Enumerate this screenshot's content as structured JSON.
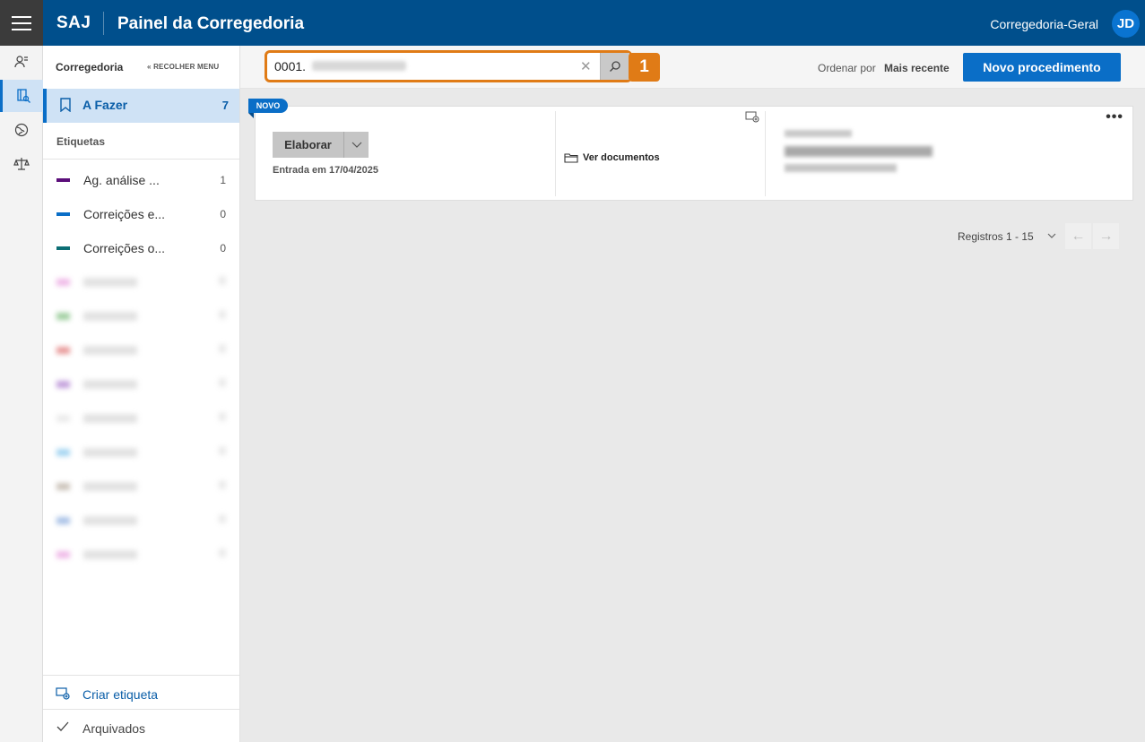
{
  "app": {
    "brand": "SAJ",
    "title": "Painel da Corregedoria",
    "user_name": "Corregedoria-Geral",
    "user_initials": "JD"
  },
  "rail": {
    "items": [
      {
        "name": "users-icon"
      },
      {
        "name": "documents-search-icon",
        "active": true
      },
      {
        "name": "globe-icon"
      },
      {
        "name": "scales-icon"
      }
    ]
  },
  "sidebar": {
    "title": "Corregedoria",
    "collapse_label": "RECOLHER MENU",
    "todo": {
      "label": "A Fazer",
      "count": "7"
    },
    "labels_title": "Etiquetas",
    "tags": [
      {
        "label": "Ag. análise ...",
        "count": "1",
        "color": "#5b0e7a"
      },
      {
        "label": "Correições e...",
        "count": "0",
        "color": "#0a6ec7"
      },
      {
        "label": "Correições o...",
        "count": "0",
        "color": "#0c6e74"
      }
    ],
    "blurred_tag_colors": [
      "#e58bd8",
      "#5fae5f",
      "#d95555",
      "#9a5ec4",
      "#dddddd",
      "#66b8e8",
      "#a89a8a",
      "#6f98d6",
      "#e58bd8"
    ],
    "create_label": "Criar etiqueta",
    "archived_label": "Arquivados"
  },
  "toolbar": {
    "search_value": "0001.",
    "step_number": "1",
    "sort_label": "Ordenar por",
    "sort_value": "Mais recente",
    "new_button": "Novo procedimento"
  },
  "card": {
    "badge": "NOVO",
    "action_button": "Elaborar",
    "entry_text": "Entrada em 17/04/2025",
    "docs_link": "Ver documentos"
  },
  "pager": {
    "records": "Registros 1 - 15"
  },
  "colors": {
    "topbar": "#004f8c",
    "accent": "#0a6ec7",
    "highlight": "#e07b16"
  }
}
